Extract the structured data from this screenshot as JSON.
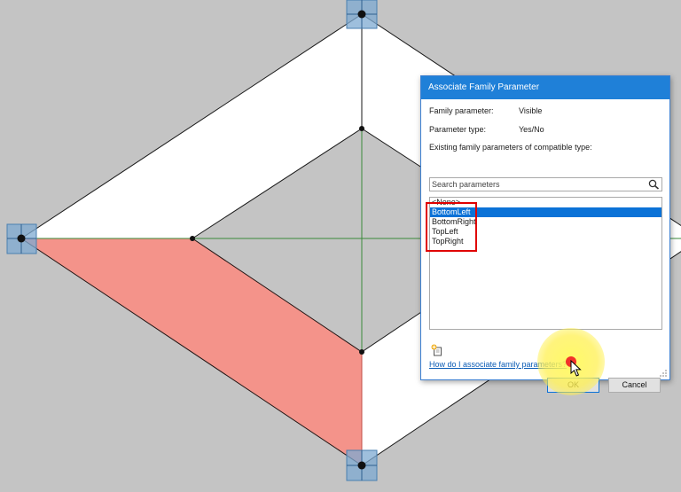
{
  "dialog": {
    "title": "Associate Family Parameter",
    "family_parameter_label": "Family parameter:",
    "family_parameter_value": "Visible",
    "parameter_type_label": "Parameter type:",
    "parameter_type_value": "Yes/No",
    "existing_label": "Existing family parameters of compatible type:",
    "search_placeholder": "Search parameters",
    "list_items": [
      "<None>",
      "BottomLeft",
      "BottomRight",
      "TopLeft",
      "TopRight"
    ],
    "selected_item": "BottomLeft",
    "help_link": "How do I associate family parameters?",
    "ok_label": "OK",
    "cancel_label": "Cancel"
  },
  "colors": {
    "background": "#c4c4c4",
    "titlebar": "#1f80d8",
    "selection": "#0b72d7",
    "highlight_box": "#e00000",
    "shape_fill": "#ffffff",
    "highlighted_region": "#f4938a",
    "reference_lines": "#3a8a3a",
    "grip_fill": "#7da9d2"
  },
  "icons": [
    "search-icon",
    "add-parameter-icon",
    "resize-grip-icon",
    "mouse-pointer-icon"
  ]
}
